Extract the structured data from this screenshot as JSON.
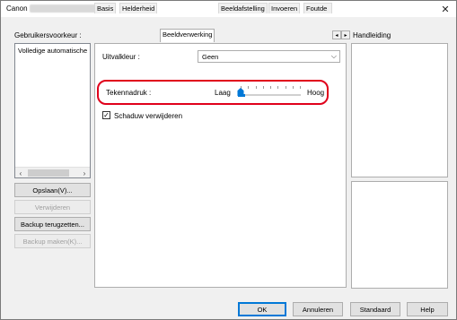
{
  "window": {
    "title": "Canon",
    "title_suffix_redacted": true,
    "close_symbol": "✕"
  },
  "sidebar": {
    "label": "Gebruikersvoorkeur :",
    "label_mnemonic": "b",
    "list_items": [
      "Volledige automatische"
    ],
    "buttons": [
      {
        "label": "Opslaan(V)...",
        "enabled": true
      },
      {
        "label": "Verwijderen",
        "enabled": false
      },
      {
        "label": "Backup terugzetten...",
        "enabled": true
      },
      {
        "label": "Backup maken(K)...",
        "enabled": false
      }
    ]
  },
  "tabs": {
    "items": [
      "Basis",
      "Helderheid",
      "Beeldverwerking",
      "Beeldafstelling",
      "Invoeren",
      "Foutde"
    ],
    "active": "Beeldverwerking",
    "scroll_left": "◂",
    "scroll_right": "▸"
  },
  "panel": {
    "dropout_label": "Uitvalkleur :",
    "dropout_value": "Geen",
    "emphasis_label": "Tekennadruk :",
    "emphasis_low": "Laag",
    "emphasis_high": "Hoog",
    "emphasis_level_fraction": 0.0,
    "shadow_label": "Schaduw verwijderen",
    "shadow_checked": true,
    "shadow_check_symbol": "✓"
  },
  "help": {
    "label": "Handleiding"
  },
  "footer": {
    "ok": "OK",
    "cancel": "Annuleren",
    "default": "Standaard",
    "help": "Help"
  },
  "colors": {
    "highlight": "#e0001b",
    "accent": "#0078d7"
  },
  "icons": {
    "close": "close-icon",
    "combo": "chevron-down-icon",
    "scroll_left": "chevron-left-icon",
    "scroll_right": "chevron-right-icon",
    "check": "check-icon"
  }
}
